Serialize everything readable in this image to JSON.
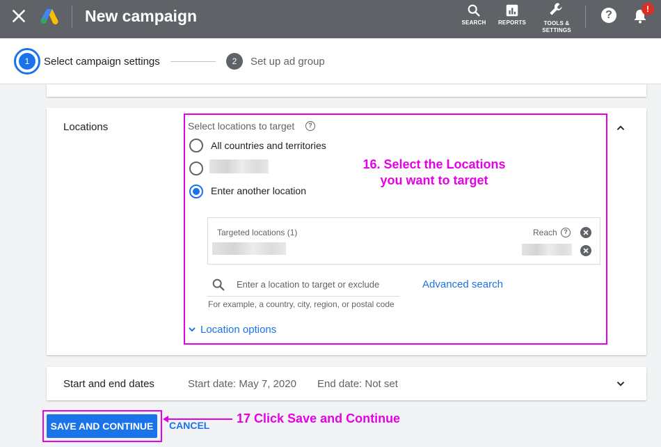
{
  "topbar": {
    "title": "New campaign",
    "tools": [
      {
        "label": "SEARCH",
        "icon": "search-icon"
      },
      {
        "label": "REPORTS",
        "icon": "reports-icon"
      },
      {
        "label_line1": "TOOLS &",
        "label_line2": "SETTINGS",
        "icon": "wrench-icon"
      }
    ],
    "help_glyph": "?",
    "notification_badge": "!",
    "bar_color": "#5f6368"
  },
  "stepper": {
    "steps": [
      {
        "number": "1",
        "label": "Select campaign settings",
        "active": true
      },
      {
        "number": "2",
        "label": "Set up ad group",
        "active": false
      }
    ]
  },
  "locations": {
    "section_title": "Locations",
    "prompt": "Select locations to target",
    "options": [
      {
        "label": "All countries and territories",
        "selected": false
      },
      {
        "label": "",
        "selected": false
      },
      {
        "label": "Enter another location",
        "selected": true
      }
    ],
    "targeted_header": "Targeted locations (1)",
    "reach_header": "Reach",
    "search_placeholder": "Enter a location to target or exclude",
    "advanced_search": "Advanced search",
    "helper_text": "For example, a country, city, region, or postal code",
    "location_options": "Location options"
  },
  "dates": {
    "section_title": "Start and end dates",
    "start": "Start date: May 7, 2020",
    "end": "End date: Not set"
  },
  "actions": {
    "save": "SAVE AND CONTINUE",
    "cancel": "CANCEL"
  },
  "annotations": {
    "step16_line1": "16. Select the Locations",
    "step16_line2": "you want to target",
    "step17": "17 Click Save and Continue",
    "color": "#e600e6"
  },
  "colors": {
    "accent": "#1a73e8",
    "background": "#f1f3f4"
  }
}
